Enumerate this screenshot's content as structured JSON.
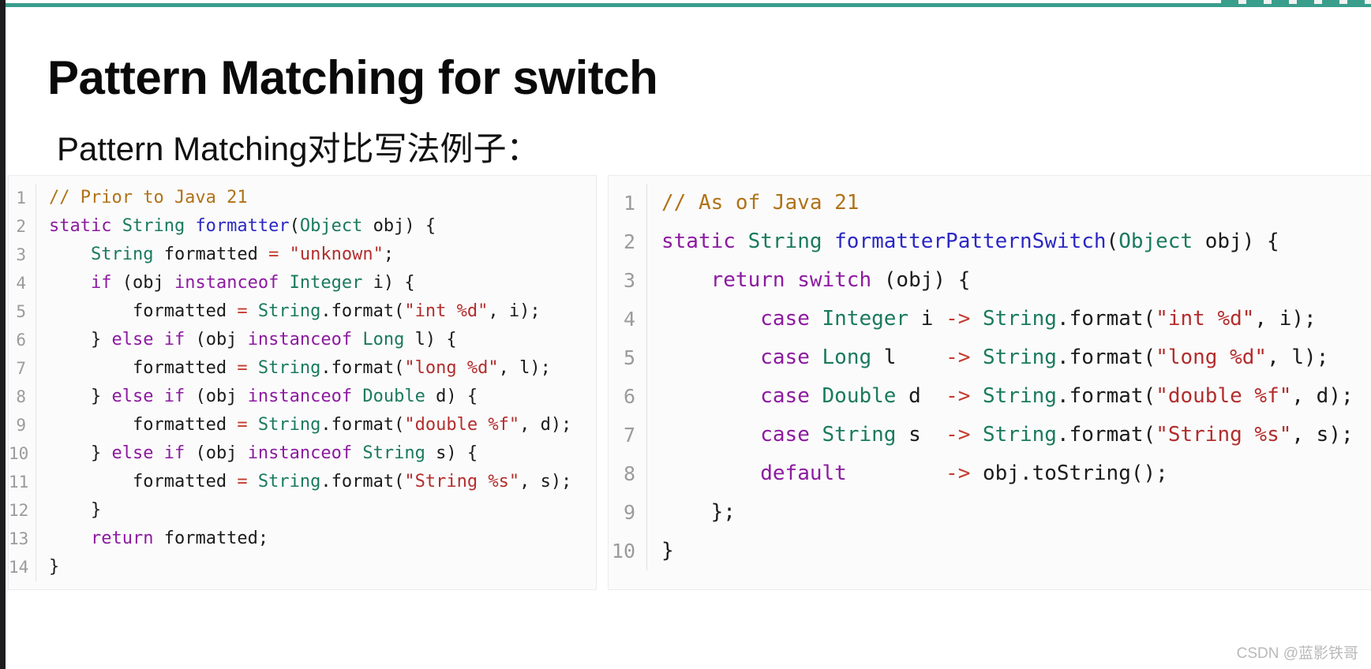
{
  "slide": {
    "title": "Pattern Matching for switch",
    "subtitle": "Pattern Matching对比写法例子：",
    "accent_color": "#3a9e8c",
    "background_color": "#ffffff"
  },
  "watermark": {
    "text": "CSDN @蓝影铁哥"
  },
  "palette": {
    "comment": "#b07219",
    "keyword": "#8c1aa0",
    "type": "#1a7a5e",
    "function": "#2b28c4",
    "string": "#b32d2d",
    "operator": "#c43b2d",
    "plain": "#1b1b1b",
    "line_number": "#9b9b9b",
    "panel_background": "#fbfbfb",
    "panel_border": "#ebebeb"
  },
  "code_left": {
    "name": "prior-to-java-21",
    "language": "java",
    "line_numbers": [
      "1",
      "2",
      "3",
      "4",
      "5",
      "6",
      "7",
      "8",
      "9",
      "10",
      "11",
      "12",
      "13",
      "14"
    ],
    "lines": [
      "// Prior to Java 21",
      "static String formatter(Object obj) {",
      "    String formatted = \"unknown\";",
      "    if (obj instanceof Integer i) {",
      "        formatted = String.format(\"int %d\", i);",
      "    } else if (obj instanceof Long l) {",
      "        formatted = String.format(\"long %d\", l);",
      "    } else if (obj instanceof Double d) {",
      "        formatted = String.format(\"double %f\", d);",
      "    } else if (obj instanceof String s) {",
      "        formatted = String.format(\"String %s\", s);",
      "    }",
      "    return formatted;",
      "}"
    ],
    "tokens": [
      [
        {
          "t": "// Prior to Java 21",
          "c": "com"
        }
      ],
      [
        {
          "t": "static ",
          "c": "kw"
        },
        {
          "t": "String ",
          "c": "typ"
        },
        {
          "t": "formatter",
          "c": "fn"
        },
        {
          "t": "(",
          "c": "pl"
        },
        {
          "t": "Object",
          "c": "typ"
        },
        {
          "t": " obj) {",
          "c": "pl"
        }
      ],
      [
        {
          "t": "    ",
          "c": "pl"
        },
        {
          "t": "String",
          "c": "typ"
        },
        {
          "t": " formatted ",
          "c": "pl"
        },
        {
          "t": "=",
          "c": "op"
        },
        {
          "t": " ",
          "c": "pl"
        },
        {
          "t": "\"unknown\"",
          "c": "str"
        },
        {
          "t": ";",
          "c": "pl"
        }
      ],
      [
        {
          "t": "    ",
          "c": "pl"
        },
        {
          "t": "if",
          "c": "kw"
        },
        {
          "t": " (obj ",
          "c": "pl"
        },
        {
          "t": "instanceof",
          "c": "kw"
        },
        {
          "t": " ",
          "c": "pl"
        },
        {
          "t": "Integer",
          "c": "typ"
        },
        {
          "t": " i) {",
          "c": "pl"
        }
      ],
      [
        {
          "t": "        formatted ",
          "c": "pl"
        },
        {
          "t": "=",
          "c": "op"
        },
        {
          "t": " ",
          "c": "pl"
        },
        {
          "t": "String",
          "c": "typ"
        },
        {
          "t": ".format(",
          "c": "pl"
        },
        {
          "t": "\"int %d\"",
          "c": "str"
        },
        {
          "t": ", i);",
          "c": "pl"
        }
      ],
      [
        {
          "t": "    } ",
          "c": "pl"
        },
        {
          "t": "else if",
          "c": "kw"
        },
        {
          "t": " (obj ",
          "c": "pl"
        },
        {
          "t": "instanceof",
          "c": "kw"
        },
        {
          "t": " ",
          "c": "pl"
        },
        {
          "t": "Long",
          "c": "typ"
        },
        {
          "t": " l) {",
          "c": "pl"
        }
      ],
      [
        {
          "t": "        formatted ",
          "c": "pl"
        },
        {
          "t": "=",
          "c": "op"
        },
        {
          "t": " ",
          "c": "pl"
        },
        {
          "t": "String",
          "c": "typ"
        },
        {
          "t": ".format(",
          "c": "pl"
        },
        {
          "t": "\"long %d\"",
          "c": "str"
        },
        {
          "t": ", l);",
          "c": "pl"
        }
      ],
      [
        {
          "t": "    } ",
          "c": "pl"
        },
        {
          "t": "else if",
          "c": "kw"
        },
        {
          "t": " (obj ",
          "c": "pl"
        },
        {
          "t": "instanceof",
          "c": "kw"
        },
        {
          "t": " ",
          "c": "pl"
        },
        {
          "t": "Double",
          "c": "typ"
        },
        {
          "t": " d) {",
          "c": "pl"
        }
      ],
      [
        {
          "t": "        formatted ",
          "c": "pl"
        },
        {
          "t": "=",
          "c": "op"
        },
        {
          "t": " ",
          "c": "pl"
        },
        {
          "t": "String",
          "c": "typ"
        },
        {
          "t": ".format(",
          "c": "pl"
        },
        {
          "t": "\"double %f\"",
          "c": "str"
        },
        {
          "t": ", d);",
          "c": "pl"
        }
      ],
      [
        {
          "t": "    } ",
          "c": "pl"
        },
        {
          "t": "else if",
          "c": "kw"
        },
        {
          "t": " (obj ",
          "c": "pl"
        },
        {
          "t": "instanceof",
          "c": "kw"
        },
        {
          "t": " ",
          "c": "pl"
        },
        {
          "t": "String",
          "c": "typ"
        },
        {
          "t": " s) {",
          "c": "pl"
        }
      ],
      [
        {
          "t": "        formatted ",
          "c": "pl"
        },
        {
          "t": "=",
          "c": "op"
        },
        {
          "t": " ",
          "c": "pl"
        },
        {
          "t": "String",
          "c": "typ"
        },
        {
          "t": ".format(",
          "c": "pl"
        },
        {
          "t": "\"String %s\"",
          "c": "str"
        },
        {
          "t": ", s);",
          "c": "pl"
        }
      ],
      [
        {
          "t": "    }",
          "c": "pl"
        }
      ],
      [
        {
          "t": "    ",
          "c": "pl"
        },
        {
          "t": "return",
          "c": "kw"
        },
        {
          "t": " formatted;",
          "c": "pl"
        }
      ],
      [
        {
          "t": "}",
          "c": "pl"
        }
      ]
    ]
  },
  "code_right": {
    "name": "as-of-java-21",
    "language": "java",
    "line_numbers": [
      "1",
      "2",
      "3",
      "4",
      "5",
      "6",
      "7",
      "8",
      "9",
      "10"
    ],
    "lines": [
      "// As of Java 21",
      "static String formatterPatternSwitch(Object obj) {",
      "    return switch (obj) {",
      "        case Integer i -> String.format(\"int %d\", i);",
      "        case Long l    -> String.format(\"long %d\", l);",
      "        case Double d  -> String.format(\"double %f\", d);",
      "        case String s  -> String.format(\"String %s\", s);",
      "        default        -> obj.toString();",
      "    };",
      "}"
    ],
    "tokens": [
      [
        {
          "t": "// As of Java 21",
          "c": "com"
        }
      ],
      [
        {
          "t": "static ",
          "c": "kw"
        },
        {
          "t": "String ",
          "c": "typ"
        },
        {
          "t": "formatterPatternSwitch",
          "c": "fn"
        },
        {
          "t": "(",
          "c": "pl"
        },
        {
          "t": "Object",
          "c": "typ"
        },
        {
          "t": " obj) {",
          "c": "pl"
        }
      ],
      [
        {
          "t": "    ",
          "c": "pl"
        },
        {
          "t": "return switch",
          "c": "kw"
        },
        {
          "t": " (obj) {",
          "c": "pl"
        }
      ],
      [
        {
          "t": "        ",
          "c": "pl"
        },
        {
          "t": "case",
          "c": "kw"
        },
        {
          "t": " ",
          "c": "pl"
        },
        {
          "t": "Integer",
          "c": "typ"
        },
        {
          "t": " i ",
          "c": "pl"
        },
        {
          "t": "->",
          "c": "op"
        },
        {
          "t": " ",
          "c": "pl"
        },
        {
          "t": "String",
          "c": "typ"
        },
        {
          "t": ".format(",
          "c": "pl"
        },
        {
          "t": "\"int %d\"",
          "c": "str"
        },
        {
          "t": ", i);",
          "c": "pl"
        }
      ],
      [
        {
          "t": "        ",
          "c": "pl"
        },
        {
          "t": "case",
          "c": "kw"
        },
        {
          "t": " ",
          "c": "pl"
        },
        {
          "t": "Long",
          "c": "typ"
        },
        {
          "t": " l    ",
          "c": "pl"
        },
        {
          "t": "->",
          "c": "op"
        },
        {
          "t": " ",
          "c": "pl"
        },
        {
          "t": "String",
          "c": "typ"
        },
        {
          "t": ".format(",
          "c": "pl"
        },
        {
          "t": "\"long %d\"",
          "c": "str"
        },
        {
          "t": ", l);",
          "c": "pl"
        }
      ],
      [
        {
          "t": "        ",
          "c": "pl"
        },
        {
          "t": "case",
          "c": "kw"
        },
        {
          "t": " ",
          "c": "pl"
        },
        {
          "t": "Double",
          "c": "typ"
        },
        {
          "t": " d  ",
          "c": "pl"
        },
        {
          "t": "->",
          "c": "op"
        },
        {
          "t": " ",
          "c": "pl"
        },
        {
          "t": "String",
          "c": "typ"
        },
        {
          "t": ".format(",
          "c": "pl"
        },
        {
          "t": "\"double %f\"",
          "c": "str"
        },
        {
          "t": ", d);",
          "c": "pl"
        }
      ],
      [
        {
          "t": "        ",
          "c": "pl"
        },
        {
          "t": "case",
          "c": "kw"
        },
        {
          "t": " ",
          "c": "pl"
        },
        {
          "t": "String",
          "c": "typ"
        },
        {
          "t": " s  ",
          "c": "pl"
        },
        {
          "t": "->",
          "c": "op"
        },
        {
          "t": " ",
          "c": "pl"
        },
        {
          "t": "String",
          "c": "typ"
        },
        {
          "t": ".format(",
          "c": "pl"
        },
        {
          "t": "\"String %s\"",
          "c": "str"
        },
        {
          "t": ", s);",
          "c": "pl"
        }
      ],
      [
        {
          "t": "        ",
          "c": "pl"
        },
        {
          "t": "default",
          "c": "kw"
        },
        {
          "t": "        ",
          "c": "pl"
        },
        {
          "t": "->",
          "c": "op"
        },
        {
          "t": " obj.toString();",
          "c": "pl"
        }
      ],
      [
        {
          "t": "    };",
          "c": "pl"
        }
      ],
      [
        {
          "t": "}",
          "c": "pl"
        }
      ]
    ]
  }
}
